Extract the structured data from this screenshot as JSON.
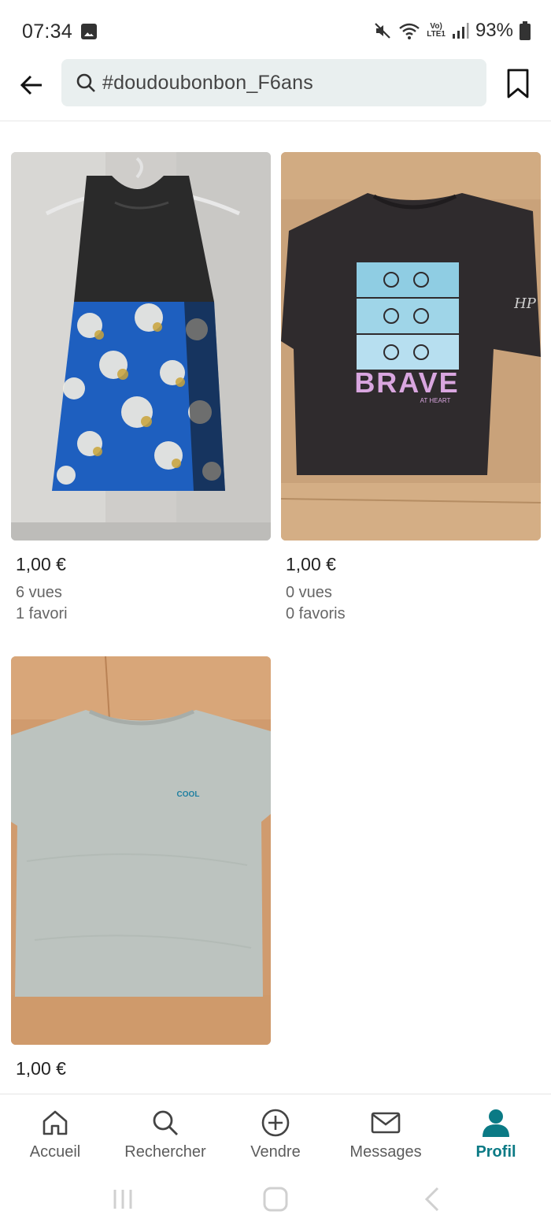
{
  "status_bar": {
    "time": "07:34",
    "lte_label_top": "Vo)",
    "lte_label_bottom": "LTE1",
    "battery": "93%"
  },
  "header": {
    "back_icon": "arrow-left-icon",
    "search_query": "#doudoubonbon_F6ans",
    "bookmark_icon": "bookmark-icon"
  },
  "items": [
    {
      "price": "1,00 €",
      "views": "6 vues",
      "favorites": "1 favori",
      "photo": "black-and-blue-print-dress"
    },
    {
      "price": "1,00 €",
      "views": "0 vues",
      "favorites": "0 favoris",
      "photo": "black-brave-at-heart-tshirt",
      "print_text": "BRAVE",
      "print_subtext": "AT HEART",
      "sleeve_text": "HP"
    },
    {
      "price": "1,00 €",
      "photo": "grey-cool-tshirt",
      "print_text": "COOL"
    }
  ],
  "bottom_nav": [
    {
      "label": "Accueil",
      "icon": "home-icon",
      "active": false
    },
    {
      "label": "Rechercher",
      "icon": "search-icon",
      "active": false
    },
    {
      "label": "Vendre",
      "icon": "plus-circle-icon",
      "active": false
    },
    {
      "label": "Messages",
      "icon": "envelope-icon",
      "active": false
    },
    {
      "label": "Profil",
      "icon": "profile-icon",
      "active": true
    }
  ],
  "colors": {
    "accent": "#0b7a85",
    "search_bg": "#e9efef"
  }
}
